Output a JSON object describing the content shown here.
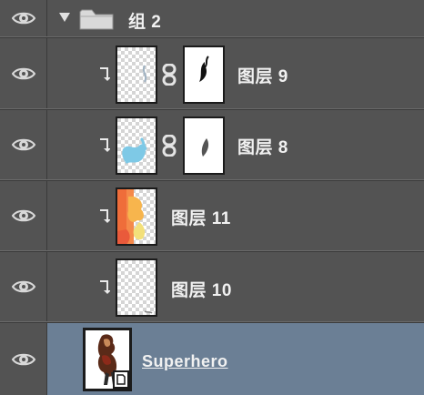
{
  "colors": {
    "panel_bg": "#535353",
    "selected_bg": "#6b7f95",
    "text": "#f1f1f1",
    "eye": "#d8d8d8"
  },
  "layers": [
    {
      "name": "组 2",
      "kind": "group",
      "icon": "folder-icon",
      "expanded": true
    },
    {
      "name": "图层 9",
      "kind": "clipped-layer-with-mask"
    },
    {
      "name": "图层 8",
      "kind": "clipped-layer-with-mask"
    },
    {
      "name": "图层 11",
      "kind": "clipped-layer"
    },
    {
      "name": "图层 10",
      "kind": "clipped-layer"
    },
    {
      "name": "Superhero",
      "kind": "smart-object",
      "selected": true
    }
  ]
}
